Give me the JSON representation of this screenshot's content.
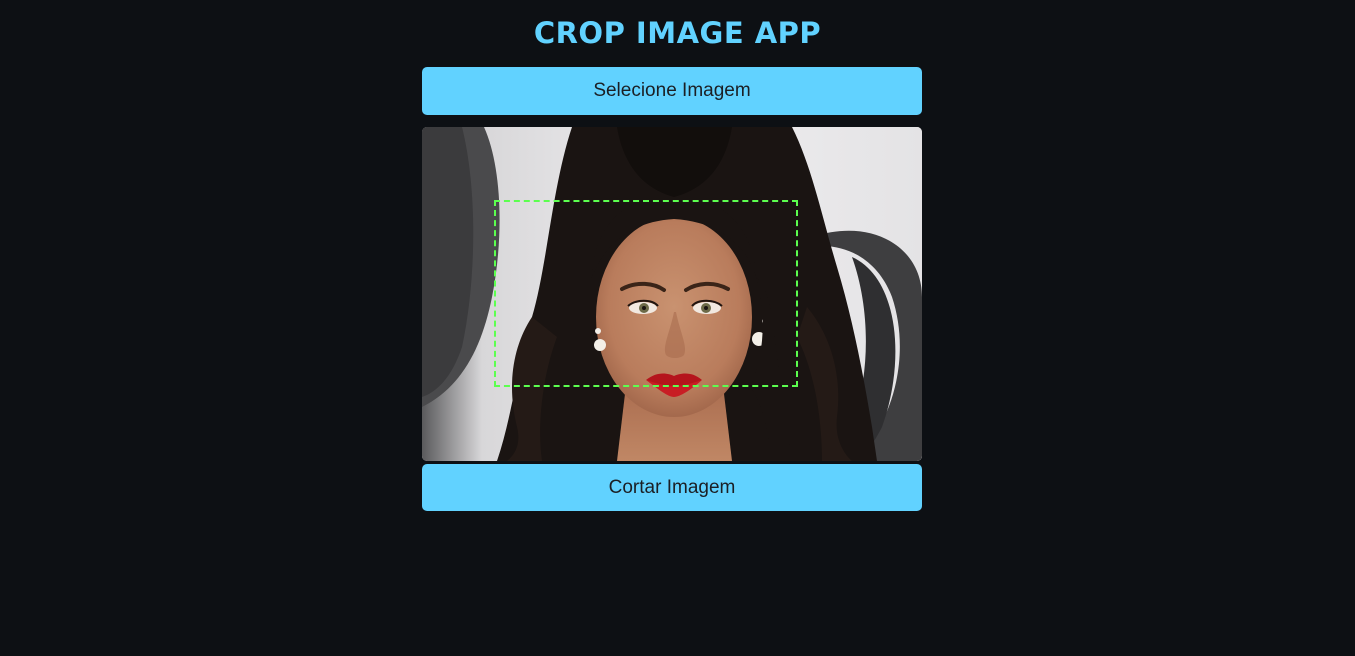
{
  "app": {
    "title": "CROP IMAGE APP"
  },
  "buttons": {
    "select_label": "Selecione Imagem",
    "crop_label": "Cortar Imagem"
  },
  "image": {
    "alt": "portrait photo with dashed crop selection"
  },
  "colors": {
    "background": "#0d1014",
    "accent": "#61d2ff",
    "crop_border": "#5cff4f",
    "button_text": "#1b1f24"
  }
}
